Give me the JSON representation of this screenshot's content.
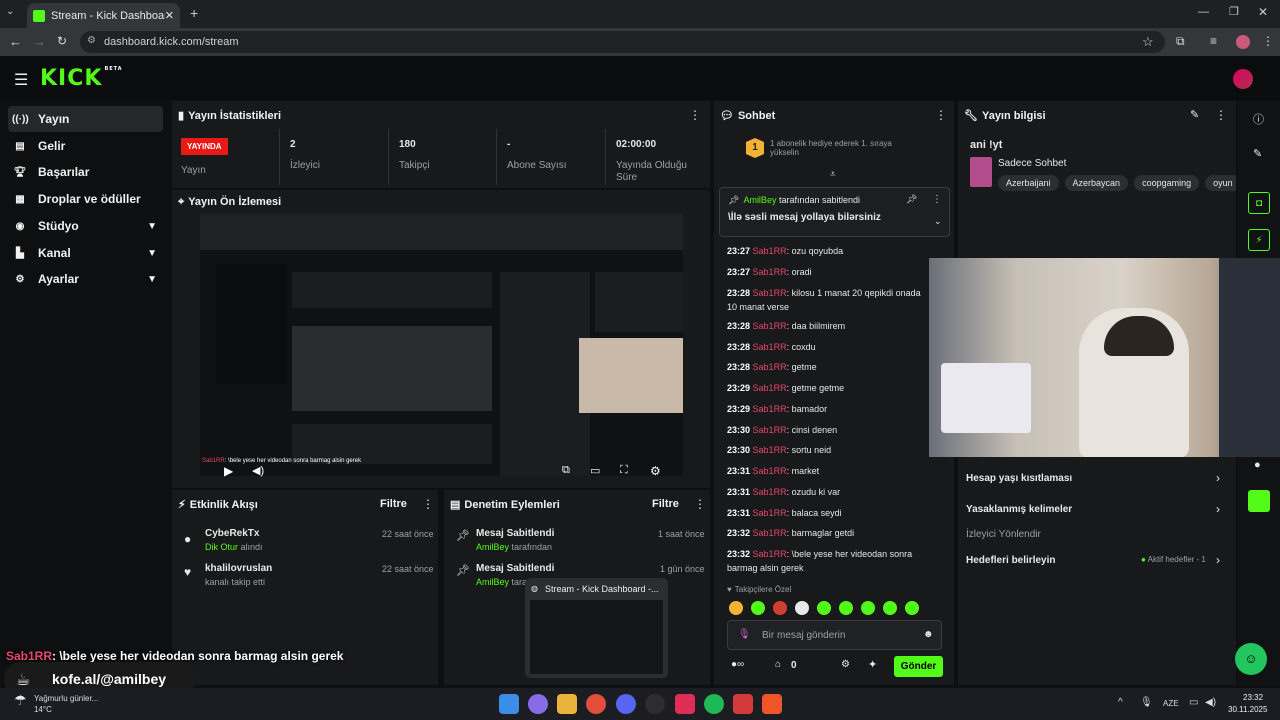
{
  "browser": {
    "tab_title": "Stream - Kick Dashboard",
    "url": "dashboard.kick.com/stream"
  },
  "kick": {
    "logo": "KICK",
    "beta": "BETA"
  },
  "sidebar": {
    "items": [
      {
        "label": "Yayın",
        "icon": "broadcast-icon"
      },
      {
        "label": "Gelir",
        "icon": "wallet-icon"
      },
      {
        "label": "Başarılar",
        "icon": "trophy-icon"
      },
      {
        "label": "Droplar ve ödüller",
        "icon": "gift-icon"
      },
      {
        "label": "Stüdyo",
        "icon": "studio-icon"
      },
      {
        "label": "Kanal",
        "icon": "channel-icon"
      },
      {
        "label": "Ayarlar",
        "icon": "settings-icon"
      }
    ]
  },
  "stats": {
    "title": "Yayın İstatistikleri",
    "live_badge": "YAYINDA",
    "live_label": "Yayın",
    "items": [
      {
        "value": "2",
        "label": "İzleyici"
      },
      {
        "value": "180",
        "label": "Takipçi"
      },
      {
        "value": "-",
        "label": "Abone Sayısı"
      },
      {
        "value": "02:00:00",
        "label": "Yayında Olduğu Süre"
      }
    ]
  },
  "preview": {
    "title": "Yayın Ön İzlemesi",
    "overlay_name": "Sab1RR",
    "overlay_text": ": \\bele yese her videodan sonra barmag alsin gerek",
    "overlay_sub": "kofe.al/@amilbey"
  },
  "activity": {
    "title": "Etkinlik Akışı",
    "filter": "Filtre",
    "items": [
      {
        "name": "CybeRekTx",
        "detail_green": "Dik Otur",
        "detail": " alındı",
        "time": "22 saat önce"
      },
      {
        "name": "khalilovruslan",
        "detail_green": "",
        "detail": "kanalı takip etti",
        "time": "22 saat önce"
      }
    ]
  },
  "moderation": {
    "title": "Denetim Eylemleri",
    "filter": "Filtre",
    "items": [
      {
        "name": "Mesaj Sabitlendi",
        "user": "AmilBey",
        "detail": " tarafından",
        "time": "1 saat önce"
      },
      {
        "name": "Mesaj Sabitlendi",
        "user": "AmilBey",
        "detail": " tara",
        "time": "1 gün önce"
      }
    ]
  },
  "chat": {
    "title": "Sohbet",
    "gift_text": "1 abonelik hediye ederek 1. sıraya yükselin",
    "gift_rank": "1",
    "pinned_user": "AmilBey",
    "pinned_by": " tarafından sabitlendi",
    "pinned_msg": "\\İlə səsli mesaj yollaya bilərsiniz",
    "messages": [
      {
        "t": "23:27",
        "u": "Sab1RR",
        "m": ": ozu qoyubda"
      },
      {
        "t": "23:27",
        "u": "Sab1RR",
        "m": ": oradi"
      },
      {
        "t": "23:28",
        "u": "Sab1RR",
        "m": ": kilosu 1 manat 20 qepikdi onada 10 manat verse"
      },
      {
        "t": "23:28",
        "u": "Sab1RR",
        "m": ": daa biilmirem"
      },
      {
        "t": "23:28",
        "u": "Sab1RR",
        "m": ": coxdu"
      },
      {
        "t": "23:28",
        "u": "Sab1RR",
        "m": ": getme"
      },
      {
        "t": "23:29",
        "u": "Sab1RR",
        "m": ": getme getme"
      },
      {
        "t": "23:29",
        "u": "Sab1RR",
        "m": ": bamador"
      },
      {
        "t": "23:30",
        "u": "Sab1RR",
        "m": ": cinsi denen"
      },
      {
        "t": "23:30",
        "u": "Sab1RR",
        "m": ": sortu neid"
      },
      {
        "t": "23:31",
        "u": "Sab1RR",
        "m": ": market"
      },
      {
        "t": "23:31",
        "u": "Sab1RR",
        "m": ": ozudu ki var"
      },
      {
        "t": "23:31",
        "u": "Sab1RR",
        "m": ": balaca seydi"
      },
      {
        "t": "23:32",
        "u": "Sab1RR",
        "m": ": barmaglar getdi"
      },
      {
        "t": "23:32",
        "u": "Sab1RR",
        "m": ": \\bele yese her videodan sonra barmag alsin gerek"
      }
    ],
    "followers_label": "Takipçilere Özel",
    "input_placeholder": "Bir mesaj gönderin",
    "points": "0",
    "send": "Gönder"
  },
  "info": {
    "title": "Yayın bilgisi",
    "stream_title": "ani !yt",
    "category": "Sadece Sohbet",
    "tags": [
      "Azerbaijani",
      "Azerbaycan",
      "coopgaming",
      "oyun"
    ],
    "rows": [
      {
        "label": "Hesap yaşı kısıtlaması"
      },
      {
        "label": "Yasaklanmış kelimeler"
      },
      {
        "label": "İzleyici Yönlendir"
      }
    ],
    "goals_label": "Hedefleri belirleyin",
    "goals_active": "Aktif hedefler - 1"
  },
  "thumbnail": {
    "title": "Stream - Kick Dashboard -..."
  },
  "weather": {
    "text": "Yağmurlu günler...",
    "temp": "14°C"
  },
  "clock": {
    "lang": "AZE",
    "time": "23:32",
    "date": "30.11.2025"
  },
  "colors": {
    "accent": "#53fc18",
    "live": "#e91916",
    "username": "#e8486b"
  }
}
